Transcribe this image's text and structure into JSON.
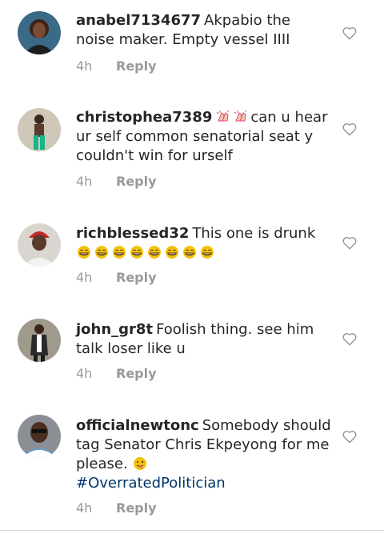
{
  "reply_label": "Reply",
  "colors": {
    "text": "#262626",
    "meta": "#999999",
    "hashtag": "#003569"
  },
  "comments": [
    {
      "username": "anabel7134677",
      "text": "Akpabio the noise maker. Empty vessel IIII",
      "time": "4h",
      "avatar": "profile-photo-woman"
    },
    {
      "username": "christophea7389",
      "emoji": "clapping-hands-icon",
      "text": "can u hear ur self common senatorial seat y couldn't win for urself",
      "time": "4h",
      "avatar": "profile-photo-man-standing"
    },
    {
      "username": "richblessed32",
      "text": "This one is drunk",
      "emoji": "grinning-face-icon",
      "time": "4h",
      "avatar": "profile-photo-man-red-cap"
    },
    {
      "username": "john_gr8t",
      "text": "Foolish thing. see him talk loser like u",
      "time": "4h",
      "avatar": "profile-photo-man-suit"
    },
    {
      "username": "officialnewtonc",
      "text": "Somebody should tag Senator Chris Ekpeyong for me please.",
      "emoji": "winking-tongue-face-icon",
      "hashtag": "#OverratedPolitician",
      "time": "4h",
      "avatar": "profile-photo-man-glasses"
    }
  ]
}
